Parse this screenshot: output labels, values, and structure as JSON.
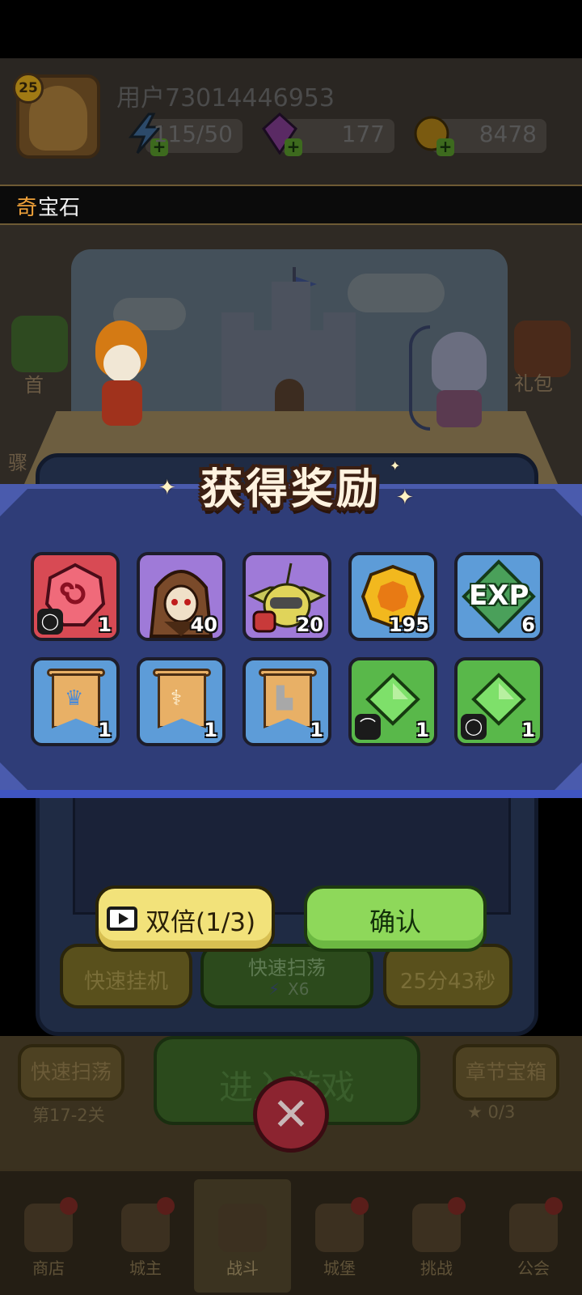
{
  "player": {
    "username": "用户73014446953",
    "level": "25",
    "energy": "115/50",
    "gems": "177",
    "coins": "8478"
  },
  "title": {
    "first_char": "奇",
    "rest": "宝石"
  },
  "reward_panel": {
    "title": "获得奖励",
    "items": [
      {
        "icon": "red-gem-icon",
        "count": "1",
        "tag": "ring-icon",
        "color": "#d84a54"
      },
      {
        "icon": "hooded-hero-portrait",
        "count": "40",
        "color": "#9f7ad8"
      },
      {
        "icon": "goblin-hero-portrait",
        "count": "20",
        "color": "#9f7ad8"
      },
      {
        "icon": "gold-coin-icon",
        "count": "195",
        "color": "#5d9cd8"
      },
      {
        "icon": "exp-icon",
        "label": "EXP",
        "count": "6",
        "color": "#5d9cd8"
      },
      {
        "icon": "crown-banner-icon",
        "count": "1",
        "color": "#5d9cd8"
      },
      {
        "icon": "staff-banner-icon",
        "count": "1",
        "color": "#5d9cd8"
      },
      {
        "icon": "boot-banner-icon",
        "count": "1",
        "color": "#5d9cd8"
      },
      {
        "icon": "green-gem-icon",
        "count": "1",
        "tag": "bow-icon",
        "color": "#59b84a"
      },
      {
        "icon": "green-gem-icon",
        "count": "1",
        "tag": "ring-icon",
        "color": "#59b84a"
      }
    ]
  },
  "buttons": {
    "double": "双倍(1/3)",
    "confirm": "确认"
  },
  "dim_actions": {
    "quick_idle": "快速挂机",
    "quick_sweep": "快速扫荡",
    "sweep_cost": "X6",
    "timer": "25分43秒"
  },
  "lower": {
    "left_button": "快速扫荡",
    "left_sub": "第17-2关",
    "enter": "进入游戏",
    "right_button": "章节宝箱",
    "right_sub": "0/3"
  },
  "side": {
    "left_label_1": "首",
    "left_label_2": "骤",
    "right_label": "礼包"
  },
  "nav": [
    {
      "label": "商店",
      "icon": "shop-icon"
    },
    {
      "label": "城主",
      "icon": "lord-icon"
    },
    {
      "label": "战斗",
      "icon": "battle-icon",
      "active": true
    },
    {
      "label": "城堡",
      "icon": "castle-icon"
    },
    {
      "label": "挑战",
      "icon": "challenge-icon"
    },
    {
      "label": "公会",
      "icon": "guild-icon"
    }
  ]
}
